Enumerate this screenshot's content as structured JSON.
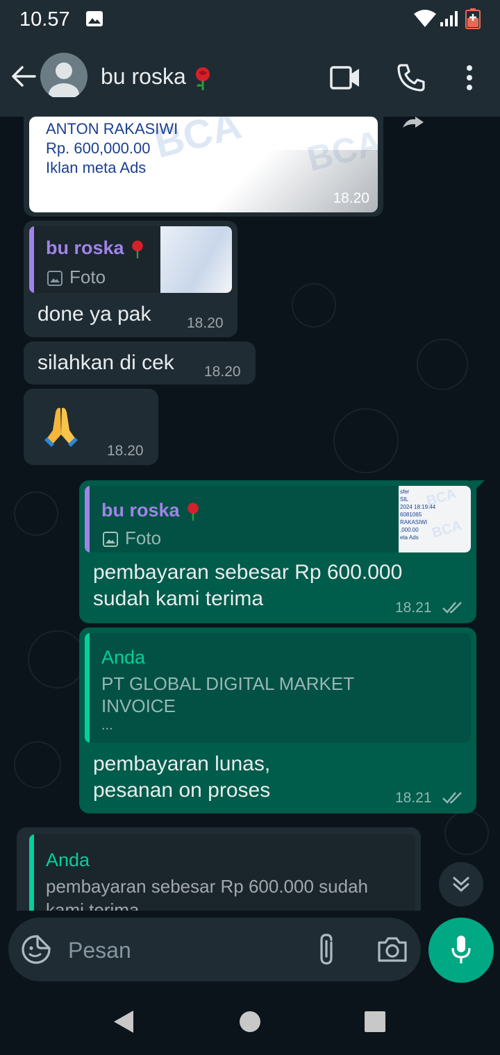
{
  "status_bar": {
    "time": "10.57"
  },
  "header": {
    "contact_name": "bu roska"
  },
  "messages": {
    "receipt": {
      "lines": [
        "ANTON RAKASIWI",
        "Rp. 600,000.00",
        "Iklan meta Ads"
      ],
      "watermark": "BCA",
      "time": "18.20"
    },
    "reply_done": {
      "quote_name": "bu roska",
      "quote_type": "Foto",
      "text": "done ya pak",
      "time": "18.20"
    },
    "silahkan": {
      "text": "silahkan di cek",
      "time": "18.20"
    },
    "pray": {
      "emoji": "🙏",
      "time": "18.20"
    },
    "out_payment": {
      "quote_name": "bu roska",
      "quote_type": "Foto",
      "thumb_lines": [
        "sfer",
        "SIL",
        "2024 18:19:44",
        "6081065",
        "RAKASIWI",
        ",000.00",
        "eta Ads"
      ],
      "thumb_watermark": "BCA",
      "line1": "pembayaran sebesar Rp 600.000",
      "line2": "sudah kami terima",
      "time": "18.21"
    },
    "out_lunas": {
      "quote_name": "Anda",
      "quote_line1": "PT GLOBAL DIGITAL MARKET",
      "quote_line2": "INVOICE",
      "quote_line3": "...",
      "line1": "pembayaran lunas,",
      "line2": "pesanan on proses",
      "time": "18.21"
    },
    "draft_reply": {
      "quote_name": "Anda",
      "quote_line1": "pembayaran sebesar Rp 600.000 sudah",
      "quote_line2": "kami terima"
    }
  },
  "input": {
    "placeholder": "Pesan"
  },
  "colors": {
    "header": "#1f2c34",
    "incoming_bubble": "#1f2c34",
    "outgoing_bubble": "#005c4b",
    "accent": "#00a884",
    "quote_purple": "#a084e8",
    "quote_green": "#06cf9c"
  }
}
